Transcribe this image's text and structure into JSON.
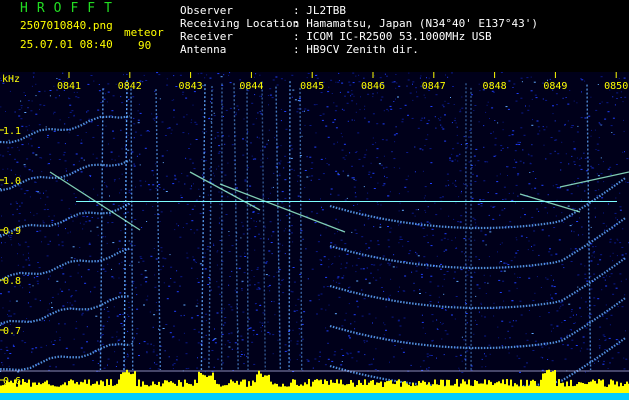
{
  "header": {
    "app_title": "HROFFT",
    "file_name": "2507010840.png",
    "date_time": "25.07.01 08:40",
    "mode_label": "meteor",
    "mode_value": "90",
    "observer_label": "Observer",
    "observer_value": ": JL2TBB",
    "location_label": "Receiving Location",
    "location_value": ": Hamamatsu, Japan (N34°40' E137°43')",
    "receiver_label": "Receiver",
    "receiver_value": ": ICOM IC-R2500 53.1000MHz USB",
    "antenna_label": "Antenna",
    "antenna_value": ": HB9CV Zenith dir."
  },
  "spectrogram": {
    "y_unit": "kHz",
    "y_ticks": [
      "1.1",
      "1.0",
      "0.9",
      "0.8",
      "0.7",
      "0.6"
    ],
    "x_ticks": [
      "0841",
      "0842",
      "0843",
      "0844",
      "0845",
      "0846",
      "0847",
      "0848",
      "0849",
      "0850"
    ],
    "colors": {
      "background": "#00001a",
      "noise_dim": "#0a1a8c",
      "noise_mid": "#1f3fff",
      "signal": "#5fa8ff",
      "hot": "#9fffd8",
      "reference_line": "#7fffff",
      "tick_text": "#ffff00",
      "amplitude_fill": "#ffff00",
      "amplitude_base": "#00ccff"
    }
  }
}
